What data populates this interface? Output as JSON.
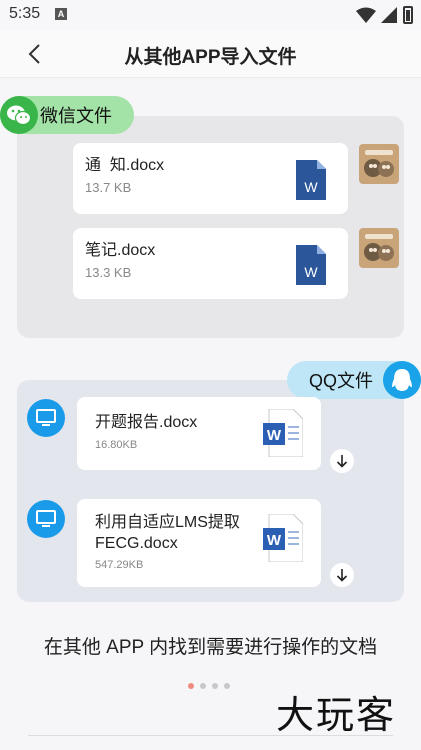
{
  "status_bar": {
    "time": "5:35",
    "notification_letter": "A"
  },
  "header": {
    "title": "从其他APP导入文件"
  },
  "wechat": {
    "label": "微信文件",
    "files": [
      {
        "name": "通  知.docx",
        "size": "13.7 KB"
      },
      {
        "name": "笔记.docx",
        "size": "13.3 KB"
      }
    ]
  },
  "qq": {
    "label": "QQ文件",
    "files": [
      {
        "name": "开题报告.docx",
        "size": "16.80KB"
      },
      {
        "name": "利用自适应LMS提取FECG.docx",
        "size": "547.29KB"
      }
    ]
  },
  "caption": "在其他 APP 内找到需要进行操作的文档",
  "pager": {
    "count": 4,
    "active": 0
  },
  "watermark": "大玩客",
  "colors": {
    "wechat_green": "#39b54a",
    "qq_blue": "#1aa3e8",
    "word_blue": "#2b579a",
    "pager_active": "#f08a7e"
  }
}
